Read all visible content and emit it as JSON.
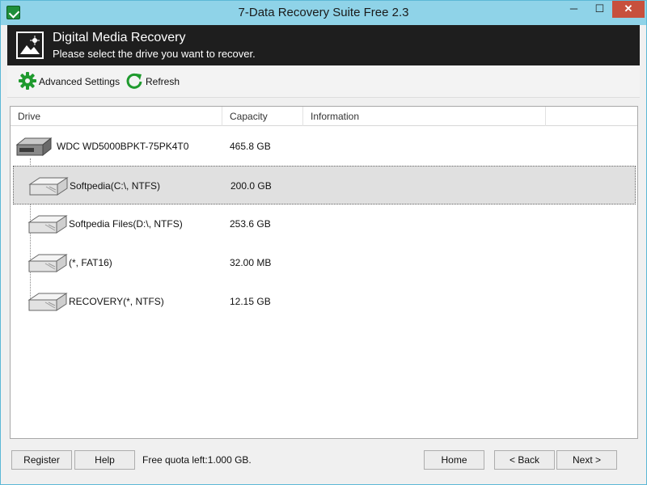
{
  "window": {
    "title": "7-Data Recovery Suite Free 2.3",
    "minimize_glyph": "─",
    "maximize_glyph": "☐",
    "close_glyph": "✕",
    "app_icon": "recovery-app-icon"
  },
  "header": {
    "icon": "image-icon",
    "title": "Digital Media Recovery",
    "subtitle": "Please select the drive you want to recover."
  },
  "toolbar": {
    "advanced_settings": {
      "label": "Advanced Settings",
      "icon": "gear-icon"
    },
    "refresh": {
      "label": "Refresh",
      "icon": "refresh-icon"
    }
  },
  "drive_list": {
    "columns": [
      "Drive",
      "Capacity",
      "Information"
    ],
    "rows": [
      {
        "name": "WDC WD5000BPKT-75PK4T0",
        "capacity": "465.8 GB",
        "information": "",
        "level": 0,
        "selected": false
      },
      {
        "name": "Softpedia(C:\\, NTFS)",
        "capacity": "200.0 GB",
        "information": "",
        "level": 1,
        "selected": true
      },
      {
        "name": "Softpedia Files(D:\\, NTFS)",
        "capacity": "253.6 GB",
        "information": "",
        "level": 1,
        "selected": false
      },
      {
        "name": "(*, FAT16)",
        "capacity": "32.00 MB",
        "information": "",
        "level": 1,
        "selected": false
      },
      {
        "name": "RECOVERY(*, NTFS)",
        "capacity": "12.15 GB",
        "information": "",
        "level": 1,
        "selected": false
      }
    ]
  },
  "footer": {
    "register": "Register",
    "help": "Help",
    "quota": "Free quota left:1.000 GB.",
    "home": "Home",
    "back": "< Back",
    "next": "Next >"
  },
  "colors": {
    "title_bar": "#8fd3e8",
    "header_bg": "#1e1e1e",
    "close_button": "#c7503d",
    "gear_green": "#1f9a2e",
    "selection_bg": "#e0e0e0"
  }
}
